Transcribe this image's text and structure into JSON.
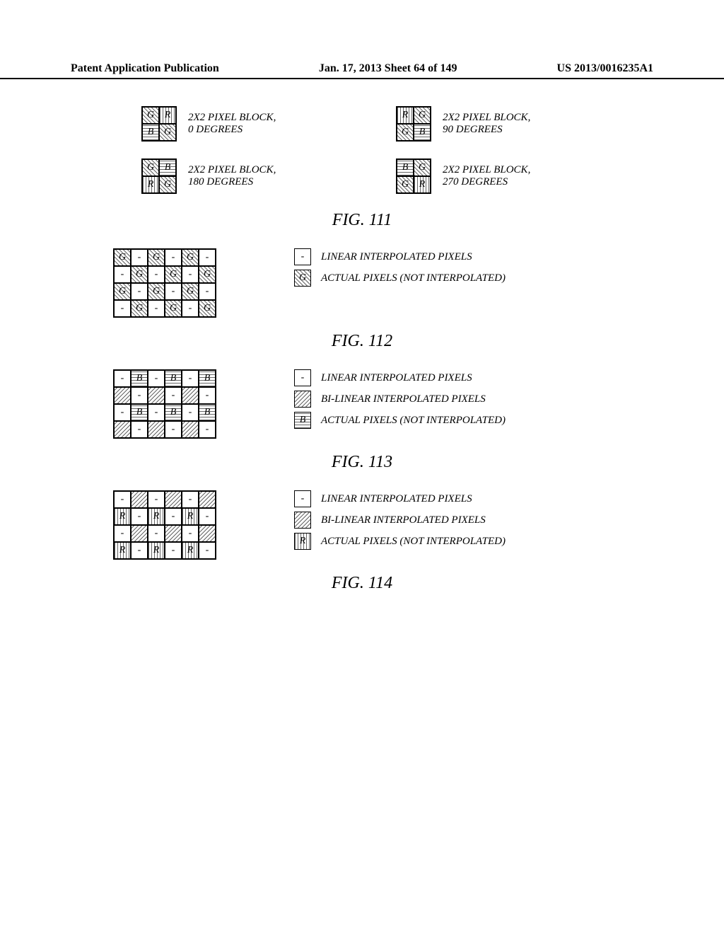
{
  "header": {
    "left": "Patent Application Publication",
    "center": "Jan. 17, 2013  Sheet 64 of 149",
    "right": "US 2013/0016235A1"
  },
  "fig111": {
    "title": "FIG. 111",
    "items": [
      {
        "desc_l1": "2X2 PIXEL BLOCK,",
        "desc_l2": "0 DEGREES",
        "cells": [
          "G",
          "R",
          "B",
          "G"
        ],
        "pats": [
          "pat-diag",
          "pat-vert",
          "pat-horiz",
          "pat-diag"
        ]
      },
      {
        "desc_l1": "2X2 PIXEL BLOCK,",
        "desc_l2": "90 DEGREES",
        "cells": [
          "R",
          "G",
          "G",
          "B"
        ],
        "pats": [
          "pat-vert",
          "pat-diag",
          "pat-diag",
          "pat-horiz"
        ]
      },
      {
        "desc_l1": "2X2 PIXEL BLOCK,",
        "desc_l2": "180 DEGREES",
        "cells": [
          "G",
          "B",
          "R",
          "G"
        ],
        "pats": [
          "pat-diag",
          "pat-horiz",
          "pat-vert",
          "pat-diag"
        ]
      },
      {
        "desc_l1": "2X2 PIXEL BLOCK,",
        "desc_l2": "270 DEGREES",
        "cells": [
          "B",
          "G",
          "G",
          "R"
        ],
        "pats": [
          "pat-horiz",
          "pat-diag",
          "pat-diag",
          "pat-vert"
        ]
      }
    ]
  },
  "fig112": {
    "title": "FIG. 112",
    "grid": [
      {
        "t": "G",
        "p": "pat-diag"
      },
      {
        "t": "-",
        "p": ""
      },
      {
        "t": "G",
        "p": "pat-diag"
      },
      {
        "t": "-",
        "p": ""
      },
      {
        "t": "G",
        "p": "pat-diag"
      },
      {
        "t": "-",
        "p": ""
      },
      {
        "t": "-",
        "p": ""
      },
      {
        "t": "G",
        "p": "pat-diag"
      },
      {
        "t": "-",
        "p": ""
      },
      {
        "t": "G",
        "p": "pat-diag"
      },
      {
        "t": "-",
        "p": ""
      },
      {
        "t": "G",
        "p": "pat-diag"
      },
      {
        "t": "G",
        "p": "pat-diag"
      },
      {
        "t": "-",
        "p": ""
      },
      {
        "t": "G",
        "p": "pat-diag"
      },
      {
        "t": "-",
        "p": ""
      },
      {
        "t": "G",
        "p": "pat-diag"
      },
      {
        "t": "-",
        "p": ""
      },
      {
        "t": "-",
        "p": ""
      },
      {
        "t": "G",
        "p": "pat-diag"
      },
      {
        "t": "-",
        "p": ""
      },
      {
        "t": "G",
        "p": "pat-diag"
      },
      {
        "t": "-",
        "p": ""
      },
      {
        "t": "G",
        "p": "pat-diag"
      }
    ],
    "legend": [
      {
        "cell": {
          "t": "-",
          "p": ""
        },
        "text": "LINEAR INTERPOLATED PIXELS"
      },
      {
        "cell": {
          "t": "G",
          "p": "pat-diag"
        },
        "text": "ACTUAL PIXELS (NOT INTERPOLATED)"
      }
    ]
  },
  "fig113": {
    "title": "FIG. 113",
    "grid": [
      {
        "t": "-",
        "p": ""
      },
      {
        "t": "B",
        "p": "pat-horiz"
      },
      {
        "t": "-",
        "p": ""
      },
      {
        "t": "B",
        "p": "pat-horiz"
      },
      {
        "t": "-",
        "p": ""
      },
      {
        "t": "B",
        "p": "pat-horiz"
      },
      {
        "t": "",
        "p": "pat-diag2"
      },
      {
        "t": "-",
        "p": ""
      },
      {
        "t": "",
        "p": "pat-diag2"
      },
      {
        "t": "-",
        "p": ""
      },
      {
        "t": "",
        "p": "pat-diag2"
      },
      {
        "t": "-",
        "p": ""
      },
      {
        "t": "-",
        "p": ""
      },
      {
        "t": "B",
        "p": "pat-horiz"
      },
      {
        "t": "-",
        "p": ""
      },
      {
        "t": "B",
        "p": "pat-horiz"
      },
      {
        "t": "-",
        "p": ""
      },
      {
        "t": "B",
        "p": "pat-horiz"
      },
      {
        "t": "",
        "p": "pat-diag2"
      },
      {
        "t": "-",
        "p": ""
      },
      {
        "t": "",
        "p": "pat-diag2"
      },
      {
        "t": "-",
        "p": ""
      },
      {
        "t": "",
        "p": "pat-diag2"
      },
      {
        "t": "-",
        "p": ""
      }
    ],
    "legend": [
      {
        "cell": {
          "t": "-",
          "p": ""
        },
        "text": "LINEAR INTERPOLATED PIXELS"
      },
      {
        "cell": {
          "t": "",
          "p": "pat-diag2"
        },
        "text": "BI-LINEAR INTERPOLATED PIXELS"
      },
      {
        "cell": {
          "t": "B",
          "p": "pat-horiz"
        },
        "text": "ACTUAL PIXELS (NOT INTERPOLATED)"
      }
    ]
  },
  "fig114": {
    "title": "FIG. 114",
    "grid": [
      {
        "t": "-",
        "p": ""
      },
      {
        "t": "",
        "p": "pat-diag2"
      },
      {
        "t": "-",
        "p": ""
      },
      {
        "t": "",
        "p": "pat-diag2"
      },
      {
        "t": "-",
        "p": ""
      },
      {
        "t": "",
        "p": "pat-diag2"
      },
      {
        "t": "R",
        "p": "pat-vert"
      },
      {
        "t": "-",
        "p": ""
      },
      {
        "t": "R",
        "p": "pat-vert"
      },
      {
        "t": "-",
        "p": ""
      },
      {
        "t": "R",
        "p": "pat-vert"
      },
      {
        "t": "-",
        "p": ""
      },
      {
        "t": "-",
        "p": ""
      },
      {
        "t": "",
        "p": "pat-diag2"
      },
      {
        "t": "-",
        "p": ""
      },
      {
        "t": "",
        "p": "pat-diag2"
      },
      {
        "t": "-",
        "p": ""
      },
      {
        "t": "",
        "p": "pat-diag2"
      },
      {
        "t": "R",
        "p": "pat-vert"
      },
      {
        "t": "-",
        "p": ""
      },
      {
        "t": "R",
        "p": "pat-vert"
      },
      {
        "t": "-",
        "p": ""
      },
      {
        "t": "R",
        "p": "pat-vert"
      },
      {
        "t": "-",
        "p": ""
      }
    ],
    "legend": [
      {
        "cell": {
          "t": "-",
          "p": ""
        },
        "text": "LINEAR INTERPOLATED PIXELS"
      },
      {
        "cell": {
          "t": "",
          "p": "pat-diag2"
        },
        "text": "BI-LINEAR INTERPOLATED PIXELS"
      },
      {
        "cell": {
          "t": "R",
          "p": "pat-vert"
        },
        "text": "ACTUAL PIXELS (NOT INTERPOLATED)"
      }
    ]
  }
}
